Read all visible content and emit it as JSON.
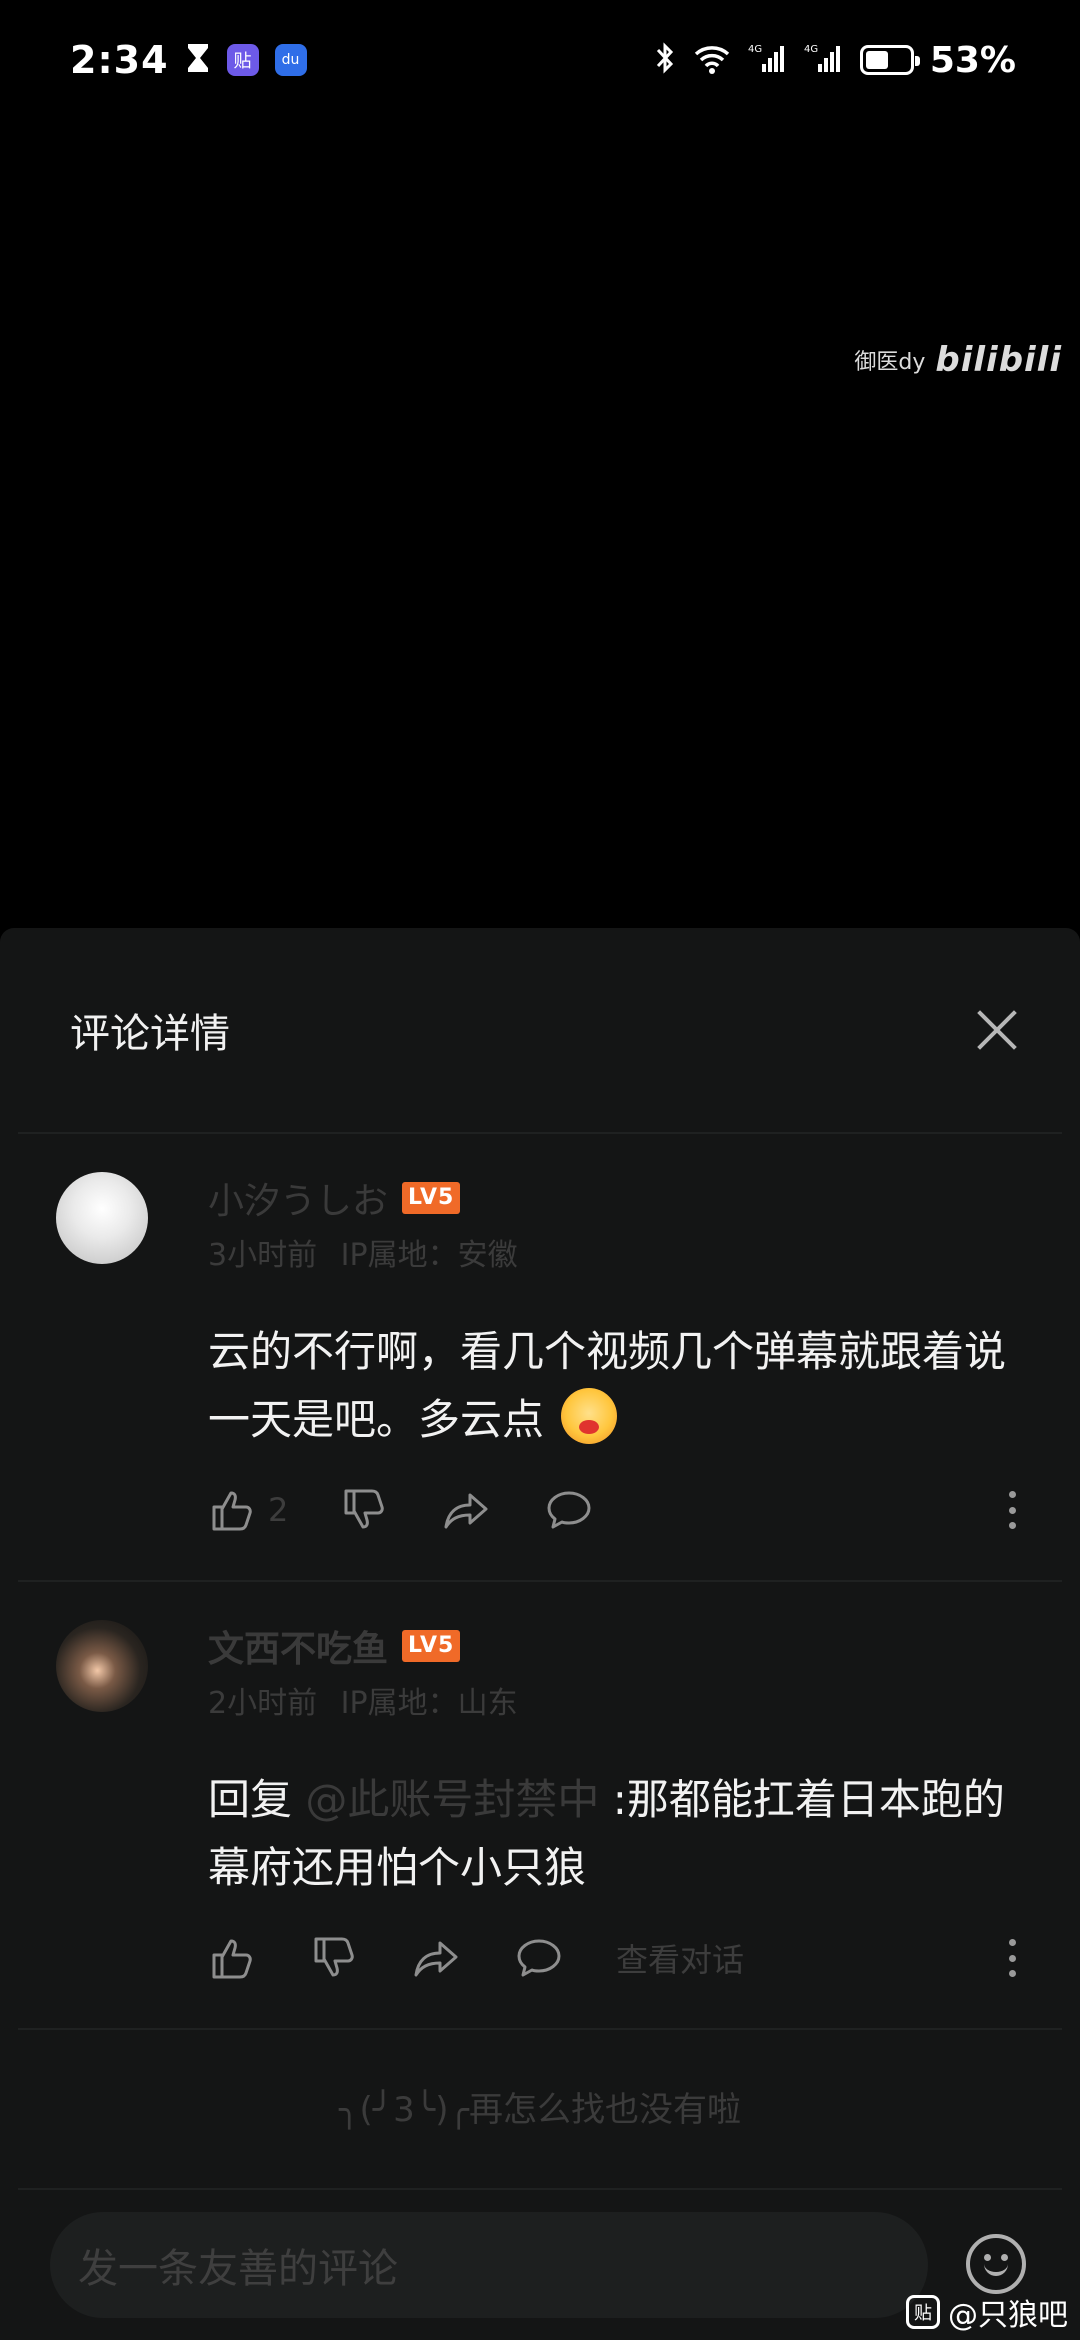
{
  "status_bar": {
    "time": "2:34",
    "battery_percent": "53%",
    "battery_level": 0.53,
    "icons": [
      "hourglass-icon",
      "tieba-app-icon",
      "baidu-app-icon",
      "bluetooth-icon",
      "wifi-icon",
      "signal-4g-icon",
      "signal-4g-icon",
      "battery-icon"
    ],
    "app_badge_tieba": "贴",
    "app_badge_baidu": "du"
  },
  "video": {
    "watermark_user": "御医dy",
    "watermark_brand": "bilibili"
  },
  "panel": {
    "title": "评论详情"
  },
  "comments": [
    {
      "username": "小汐うしお",
      "level": "LV5",
      "time": "3小时前",
      "ip": "IP属地：安徽",
      "text": "云的不行啊，看几个视频几个弹幕就跟着说一天是吧。多云点",
      "emoji": "drooling-face-emoji",
      "likes": "2"
    },
    {
      "username": "文西不吃鱼",
      "level": "LV5",
      "time": "2小时前",
      "ip": "IP属地：山东",
      "reply_prefix": "回复 ",
      "mention": "@此账号封禁中",
      "text": " :那都能扛着日本跑的幕府还用怕个小只狼",
      "view_conversation": "查看对话"
    }
  ],
  "end_of_list": "╮(╯3╰)╭再怎么找也没有啦",
  "composer": {
    "placeholder": "发一条友善的评论"
  },
  "footer_watermark": {
    "logo": "贴",
    "text": "@只狼吧"
  },
  "colors": {
    "panel_bg": "#141515",
    "level_badge": "#f06a28",
    "muted_text": "#3b3b3b"
  }
}
